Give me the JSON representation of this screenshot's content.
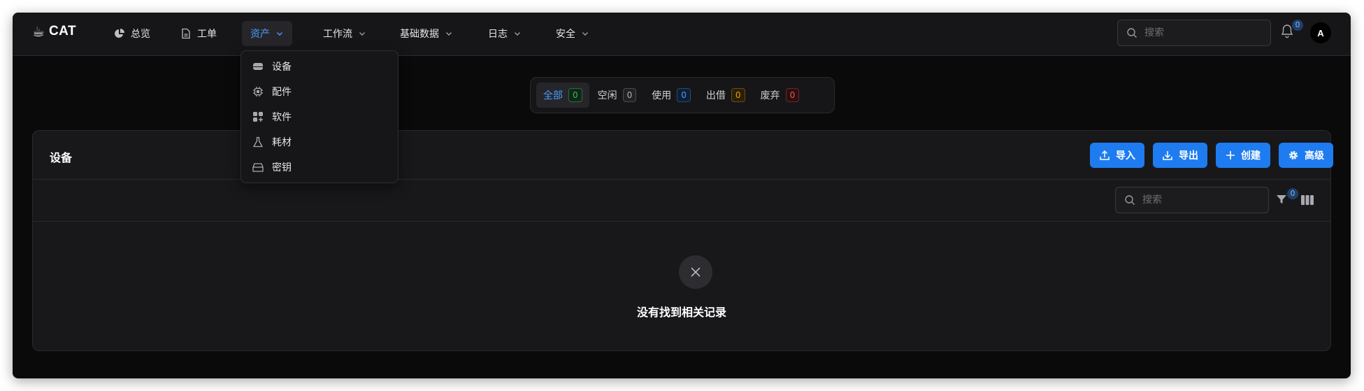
{
  "app": {
    "logo_icon": "☕",
    "logo_text": "CAT"
  },
  "nav": {
    "items": [
      {
        "label": "总览",
        "icon": "pie-chart-icon"
      },
      {
        "label": "工单",
        "icon": "document-icon"
      },
      {
        "label": "资产",
        "active": true
      },
      {
        "label": "工作流"
      },
      {
        "label": "基础数据"
      },
      {
        "label": "日志"
      },
      {
        "label": "安全"
      }
    ],
    "search_placeholder": "搜索",
    "notification_count": "0",
    "avatar_letter": "A"
  },
  "asset_menu": {
    "items": [
      {
        "label": "设备",
        "icon": "server-icon"
      },
      {
        "label": "配件",
        "icon": "chip-icon"
      },
      {
        "label": "软件",
        "icon": "apps-icon"
      },
      {
        "label": "耗材",
        "icon": "flask-icon"
      },
      {
        "label": "密钥",
        "icon": "key-drawer-icon"
      }
    ]
  },
  "status_filter": {
    "tabs": [
      {
        "label": "全部",
        "count": "0",
        "color": "#3fb950",
        "active": true
      },
      {
        "label": "空闲",
        "count": "0",
        "color": "#8b8b90"
      },
      {
        "label": "使用",
        "count": "0",
        "color": "#4a9bff"
      },
      {
        "label": "出借",
        "count": "0",
        "color": "#e3a008"
      },
      {
        "label": "废弃",
        "count": "0",
        "color": "#f05252"
      }
    ]
  },
  "card": {
    "title": "设备",
    "buttons": {
      "import": "导入",
      "export": "导出",
      "create": "创建",
      "advanced": "高级"
    },
    "search_placeholder": "搜索",
    "filter_count": "0",
    "empty_text": "没有找到相关记录"
  },
  "colors": {
    "accent": "#1e7cf0",
    "background": "#0a0a0b",
    "surface": "#18181b"
  }
}
